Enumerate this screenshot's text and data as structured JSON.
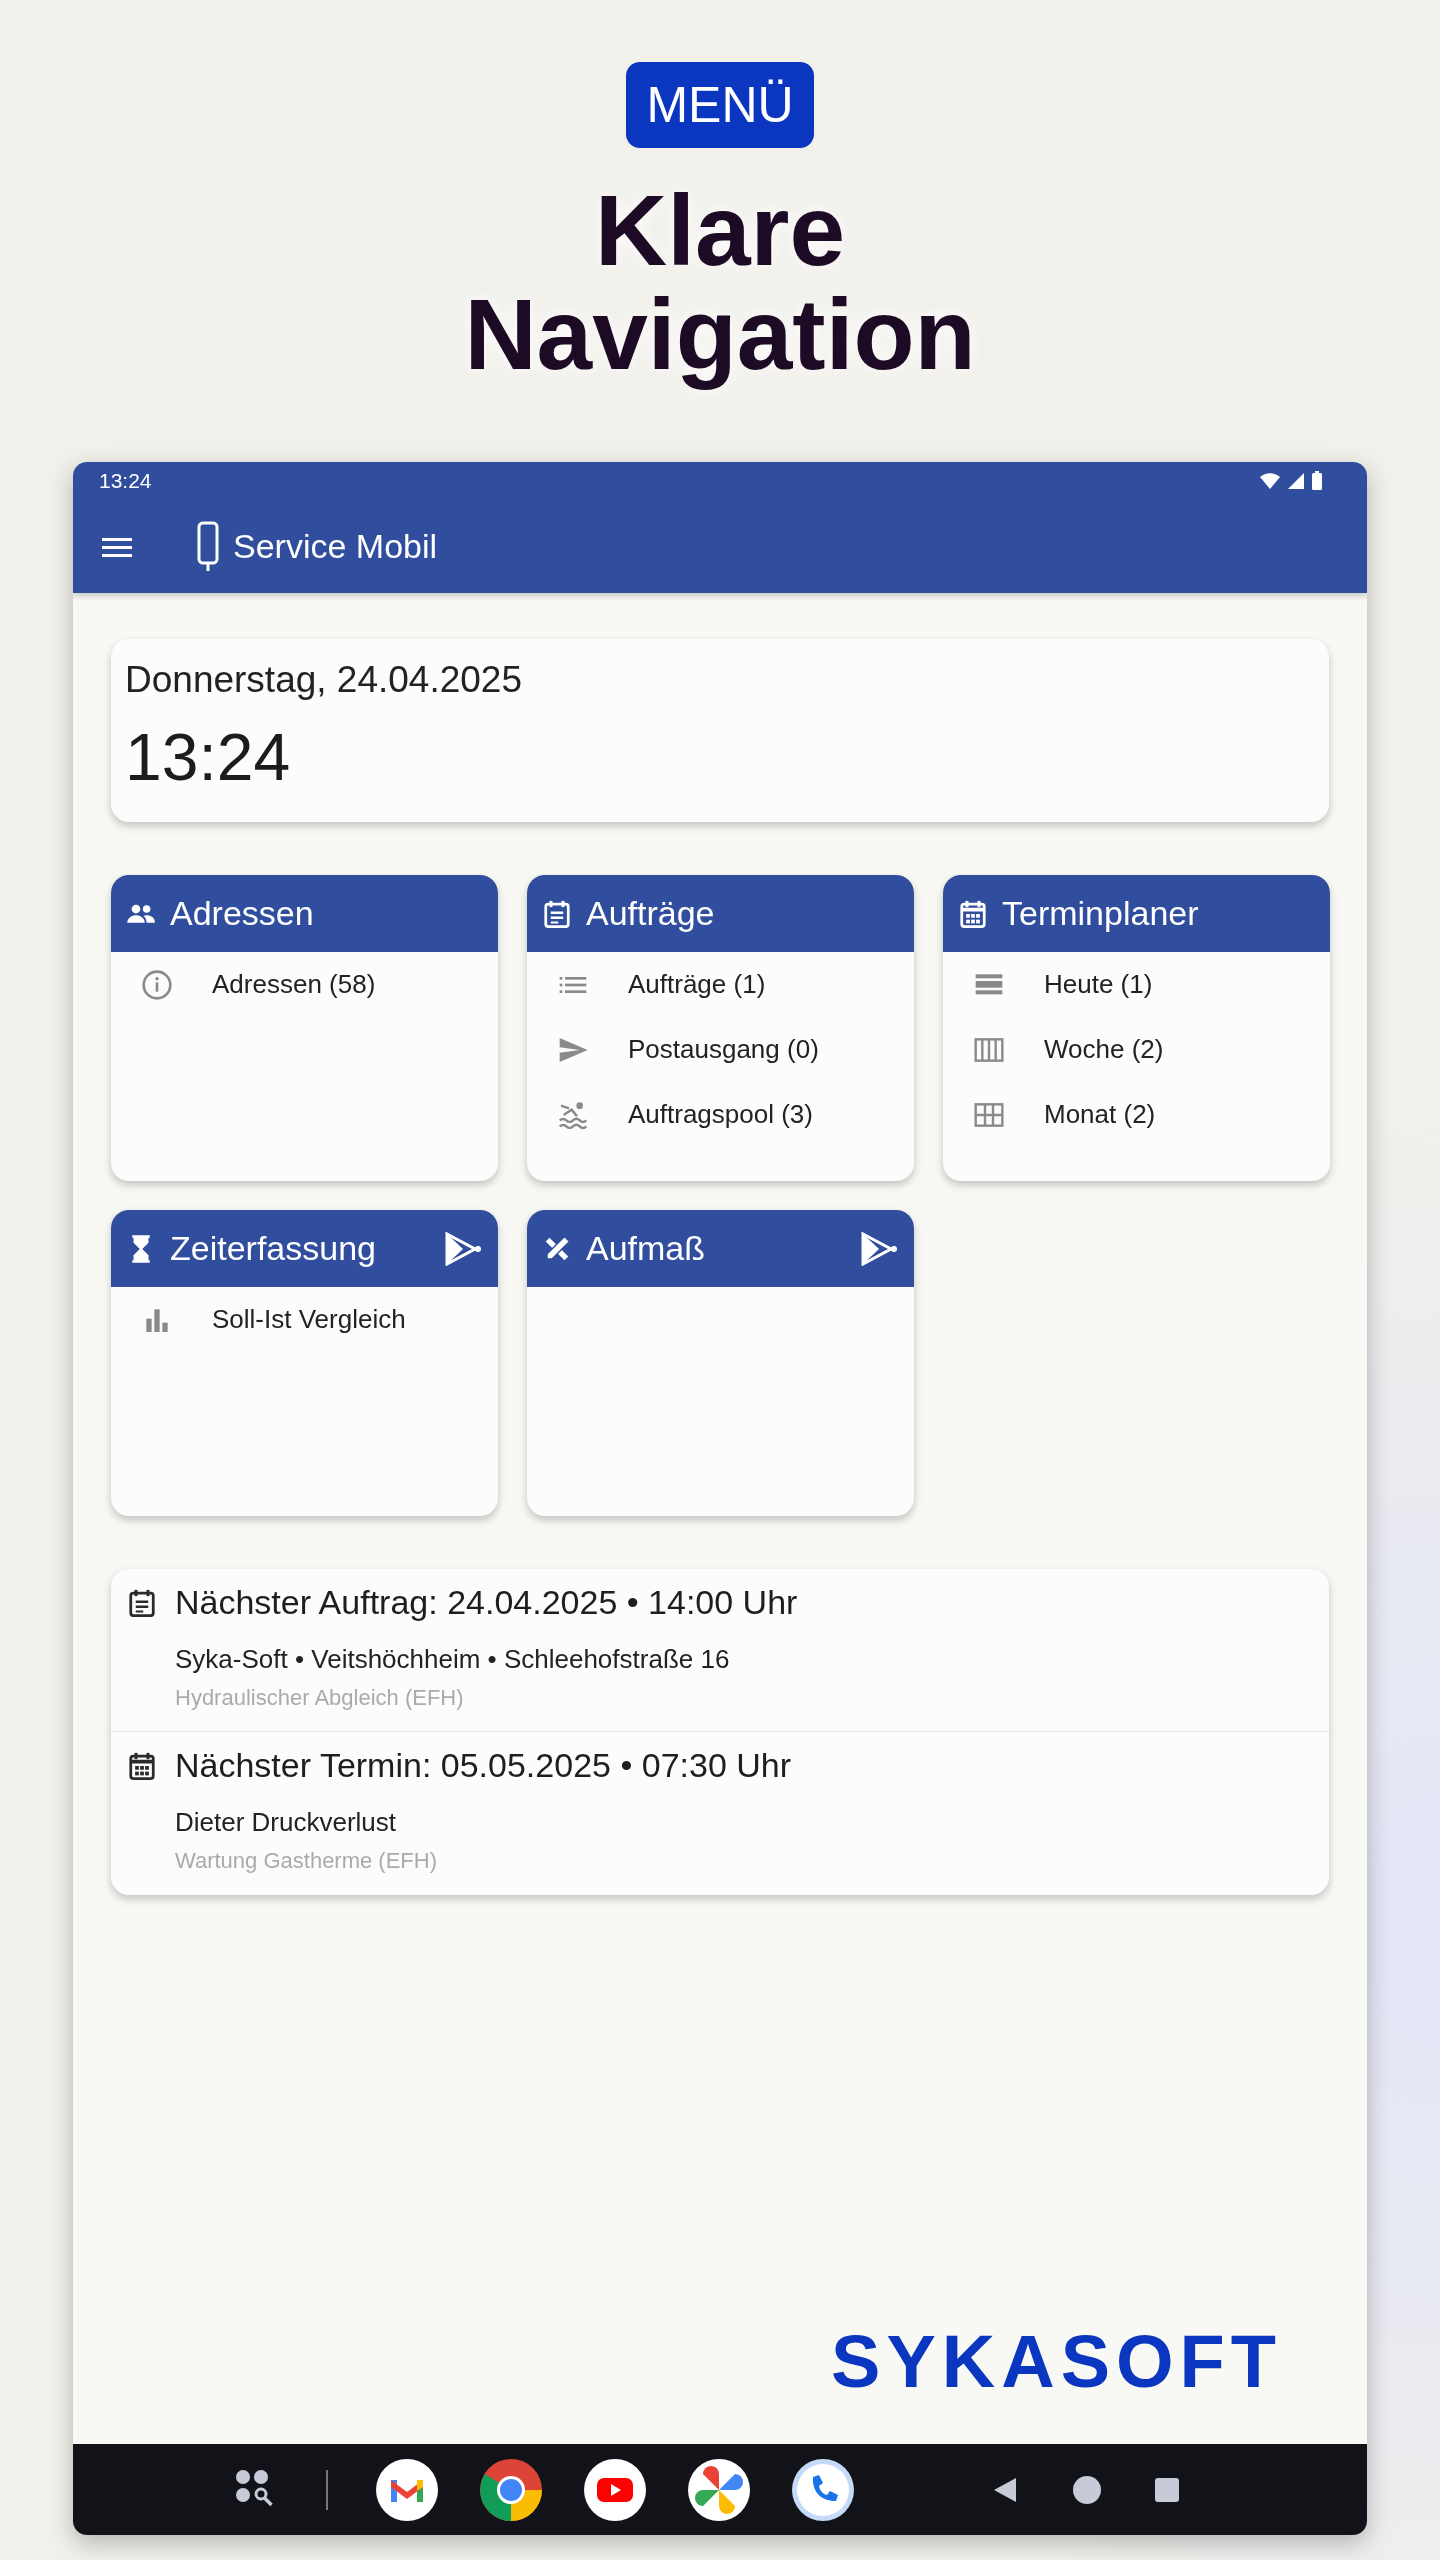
{
  "badge": "MENÜ",
  "headline_lines": [
    "Klare",
    "Navigation"
  ],
  "status_bar": {
    "time": "13:24"
  },
  "app_bar": {
    "title": "Service Mobil"
  },
  "date_card": {
    "date": "Donnerstag, 24.04.2025",
    "time": "13:24"
  },
  "tiles": [
    {
      "title": "Adressen",
      "action": false,
      "items": [
        {
          "label": "Adressen (58)"
        }
      ]
    },
    {
      "title": "Aufträge",
      "action": false,
      "items": [
        {
          "label": "Aufträge (1)"
        },
        {
          "label": "Postausgang (0)"
        },
        {
          "label": "Auftragspool (3)"
        }
      ]
    },
    {
      "title": "Terminplaner",
      "action": false,
      "items": [
        {
          "label": "Heute (1)"
        },
        {
          "label": "Woche (2)"
        },
        {
          "label": "Monat (2)"
        }
      ]
    },
    {
      "title": "Zeiterfassung",
      "action": true,
      "items": [
        {
          "label": "Soll-Ist Vergleich"
        }
      ]
    },
    {
      "title": "Aufmaß",
      "action": true
    }
  ],
  "upcoming": [
    {
      "heading": "Nächster Auftrag: 24.04.2025 • 14:00 Uhr",
      "line": "Syka-Soft • Veitshöchheim • Schleehofstraße 16",
      "detail": "Hydraulischer Abgleich (EFH)"
    },
    {
      "heading": "Nächster Termin: 05.05.2025 • 07:30 Uhr",
      "line": "Dieter Druckverlust",
      "detail": "Wartung Gastherme (EFH)"
    }
  ],
  "logo": "SYKASOFT"
}
